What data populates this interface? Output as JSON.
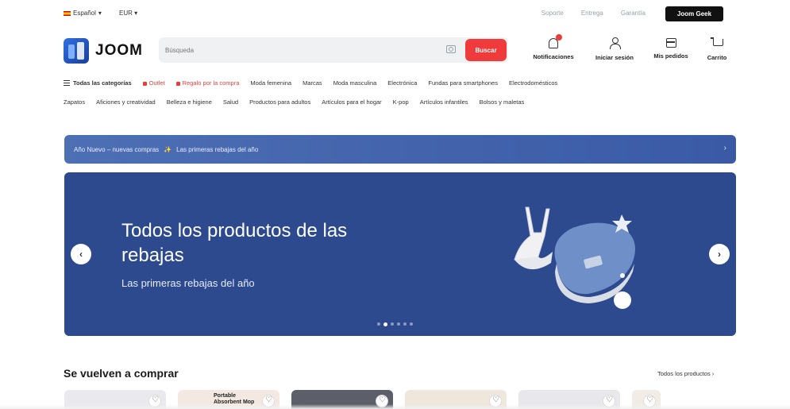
{
  "topbar": {
    "language": "Español",
    "currency": "EUR",
    "links": [
      "Soporte",
      "Entrega",
      "Garantía"
    ],
    "cta": "Joom Geek"
  },
  "header": {
    "logo_text": "JOOM",
    "search_placeholder": "Búsqueda",
    "search_button": "Buscar",
    "actions": [
      {
        "label": "Notificaciones",
        "icon": "bell-icon"
      },
      {
        "label": "Iniciar sesión",
        "icon": "user-icon"
      },
      {
        "label": "Mis pedidos",
        "icon": "orders-icon"
      },
      {
        "label": "Carrito",
        "icon": "cart-icon"
      }
    ]
  },
  "categories": {
    "row1": [
      "Todas las categorías",
      "Outlet",
      "Regalo por la compra",
      "Moda femenina",
      "Marcas",
      "Moda masculina",
      "Electrónica",
      "Fundas para smartphones",
      "Electrodomésticos"
    ],
    "row2": [
      "Zapatos",
      "Aficiones y creatividad",
      "Belleza e higiene",
      "Salud",
      "Productos para adultos",
      "Artículos para el hogar",
      "K-pop",
      "Artículos infantiles",
      "Bolsos y maletas"
    ]
  },
  "promo": {
    "text": "Año Nuevo – nuevas compras",
    "sparkle": "✨",
    "secondary": "Las primeras rebajas del año",
    "arrow": "›"
  },
  "hero": {
    "title": "Todos los productos de las rebajas",
    "subtitle": "Las primeras rebajas del año",
    "prev": "‹",
    "next": "›",
    "slides_count": 6,
    "active_slide": 2
  },
  "section": {
    "title": "Se vuelven a comprar",
    "link": "Todos los productos ›",
    "cards": [
      {
        "bg": "#e9e9ee",
        "label": ""
      },
      {
        "bg": "#f3e9e2",
        "label": "Portable Absorbent Mop"
      },
      {
        "bg": "#5c5f6a",
        "label": ""
      },
      {
        "bg": "#efe6dc",
        "label": ""
      },
      {
        "bg": "#e8e8ec",
        "label": ""
      },
      {
        "bg": "#f2ece6",
        "label": ""
      }
    ]
  },
  "colors": {
    "accent_red": "#ef3b3b",
    "promo_blue": "#4d6fb4",
    "hero_blue": "#2d4a8e"
  }
}
